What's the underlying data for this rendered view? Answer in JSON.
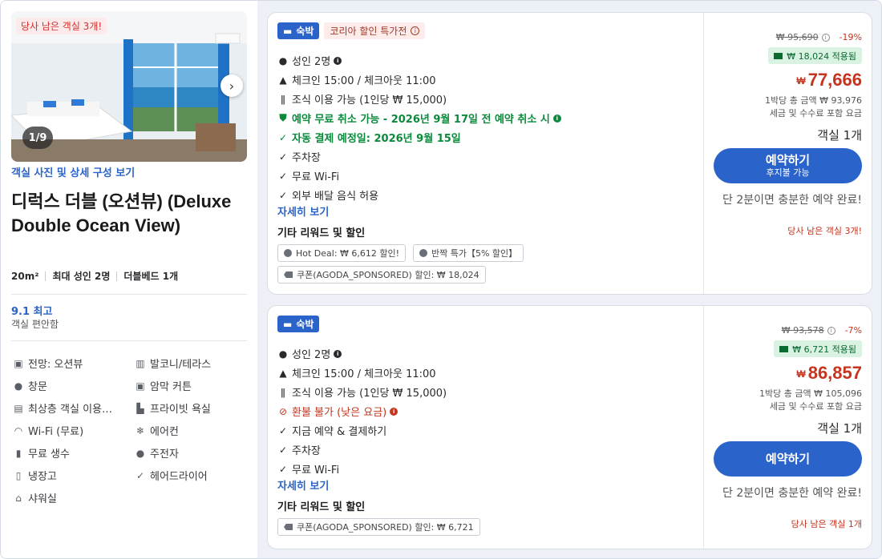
{
  "room": {
    "photo_badge": "당사 남은 객실 3개!",
    "photo_counter": "1/9",
    "photo_link": "객실 사진 및 상세 구성 보기",
    "title": "디럭스 더블 (오션뷰) (Deluxe Double Ocean View)",
    "size": "20m²",
    "occupancy": "최대 성인 2명",
    "bed": "더블베드 1개",
    "score": "9.1 최고",
    "score_sub": "객실 편안함",
    "amenities": [
      {
        "label": "전망: 오션뷰",
        "icon": "view-icon"
      },
      {
        "label": "발코니/테라스",
        "icon": "balcony-icon"
      },
      {
        "label": "창문",
        "icon": "window-icon"
      },
      {
        "label": "암막 커튼",
        "icon": "curtain-icon"
      },
      {
        "label": "최상층 객실 이용…",
        "icon": "top-floor-icon"
      },
      {
        "label": "프라이빗 욕실",
        "icon": "bathtub-icon"
      },
      {
        "label": "Wi-Fi (무료)",
        "icon": "wifi-icon"
      },
      {
        "label": "에어컨",
        "icon": "snowflake-icon"
      },
      {
        "label": "무료 생수",
        "icon": "water-icon"
      },
      {
        "label": "주전자",
        "icon": "kettle-icon"
      },
      {
        "label": "냉장고",
        "icon": "fridge-icon"
      },
      {
        "label": "헤어드라이어",
        "icon": "hairdryer-icon"
      },
      {
        "label": "샤워실",
        "icon": "shower-icon"
      }
    ]
  },
  "offers": [
    {
      "stay_tag": "숙박",
      "promo_tag": "코리아 할인 특가전",
      "features": [
        {
          "text": "성인 2명",
          "icon": "person-icon",
          "style": "normal",
          "info": true
        },
        {
          "text": "체크인 15:00 / 체크아웃 11:00",
          "icon": "bell-icon",
          "style": "normal"
        },
        {
          "text": "조식 이용 가능 (1인당 ₩ 15,000)",
          "icon": "fork-knife-icon",
          "style": "normal"
        },
        {
          "text": "예약 무료 취소 가능 - 2026년 9월 17일 전 예약 취소 시",
          "icon": "shield-check-icon",
          "style": "green",
          "info": true
        },
        {
          "text": "자동 결제 예정일: 2026년 9월 15일",
          "icon": "check-icon",
          "style": "green"
        },
        {
          "text": "주차장",
          "icon": "check-icon",
          "style": "normal"
        },
        {
          "text": "무료 Wi-Fi",
          "icon": "check-icon",
          "style": "normal"
        },
        {
          "text": "외부 배달 음식 허용",
          "icon": "check-icon",
          "style": "normal"
        }
      ],
      "more_link": "자세히 보기",
      "rewards_heading": "기타 리워드 및 할인",
      "chips": [
        {
          "text": "Hot Deal: ₩ 6,612 할인!",
          "icon": "deal-icon"
        },
        {
          "text": "반짝 특가【5% 할인】",
          "icon": "deal-icon"
        },
        {
          "text": "쿠폰(AGODA_SPONSORED) 할인: ₩ 18,024",
          "icon": "coupon-icon"
        }
      ],
      "original_price": "₩ 95,690",
      "discount_pct": "-19%",
      "applied": "₩ 18,024 적용됨",
      "currency": "₩",
      "price": "77,666",
      "per_night": "1박당 총 금액 ₩ 93,976",
      "tax_note": "세금 및 수수료 포함 요금",
      "rooms": "객실 1개",
      "book_label": "예약하기",
      "book_sub": "후지불 가능",
      "quick_note": "단 2분이면 충분한 예약 완료!",
      "rooms_left": "당사 남은 객실 3개!"
    },
    {
      "stay_tag": "숙박",
      "features": [
        {
          "text": "성인 2명",
          "icon": "person-icon",
          "style": "normal",
          "info": true
        },
        {
          "text": "체크인 15:00 / 체크아웃 11:00",
          "icon": "bell-icon",
          "style": "normal"
        },
        {
          "text": "조식 이용 가능 (1인당 ₩ 15,000)",
          "icon": "fork-knife-icon",
          "style": "normal"
        },
        {
          "text": "환불 불가 (낮은 요금)",
          "icon": "no-refund-icon",
          "style": "red",
          "info": true
        },
        {
          "text": "지금 예약 & 결제하기",
          "icon": "check-icon",
          "style": "normal"
        },
        {
          "text": "주차장",
          "icon": "check-icon",
          "style": "normal"
        },
        {
          "text": "무료 Wi-Fi",
          "icon": "check-icon",
          "style": "normal"
        }
      ],
      "more_link": "자세히 보기",
      "rewards_heading": "기타 리워드 및 할인",
      "chips": [
        {
          "text": "쿠폰(AGODA_SPONSORED) 할인: ₩ 6,721",
          "icon": "coupon-icon"
        }
      ],
      "original_price": "₩ 93,578",
      "discount_pct": "-7%",
      "applied": "₩ 6,721 적용됨",
      "currency": "₩",
      "price": "86,857",
      "per_night": "1박당 총 금액 ₩ 105,096",
      "tax_note": "세금 및 수수료 포함 요금",
      "rooms": "객실 1개",
      "book_label": "예약하기",
      "quick_note": "단 2분이면 충분한 예약 완료!",
      "rooms_left": "당사 남은 객실 1개"
    }
  ],
  "colors": {
    "accent_blue": "#2a63c9",
    "price_red": "#c4341e",
    "success_green": "#0b8a3c",
    "applied_bg": "#d9f2e1"
  }
}
